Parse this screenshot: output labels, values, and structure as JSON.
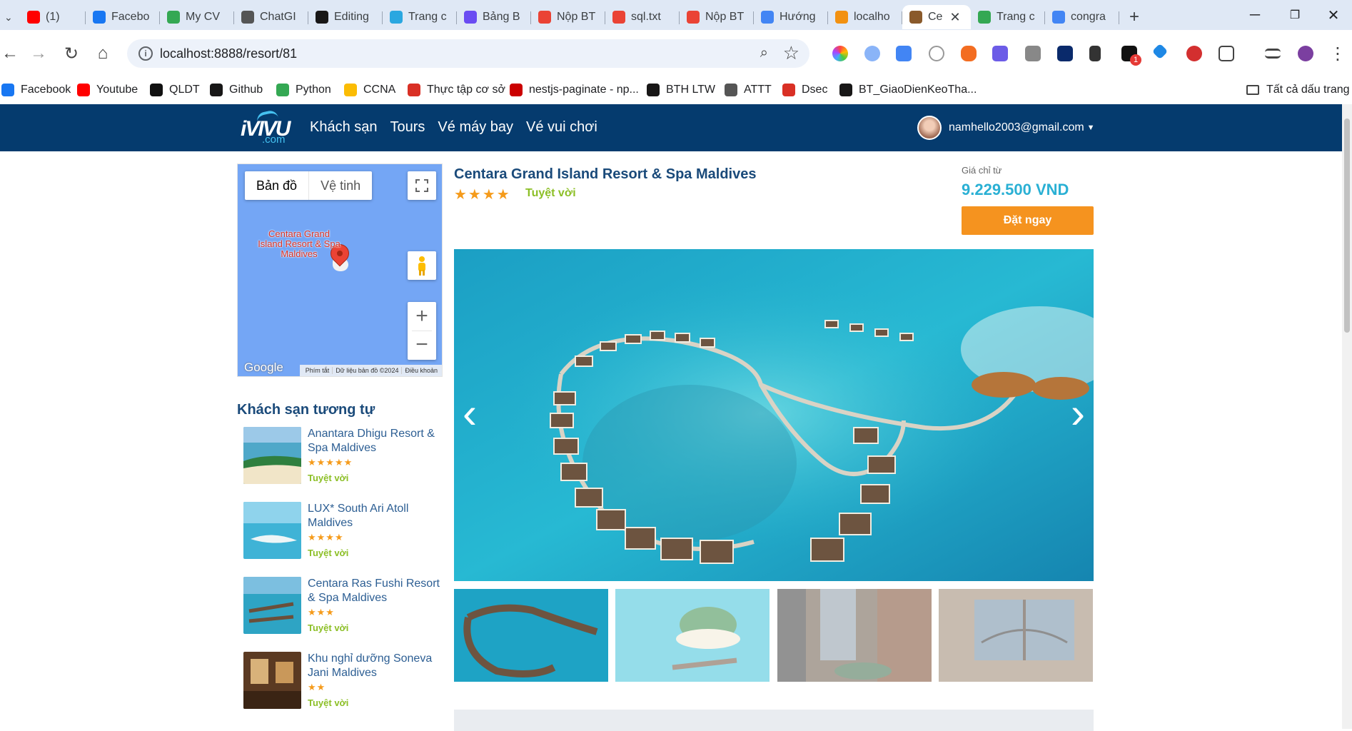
{
  "browser": {
    "tabs": [
      {
        "label": "(1)",
        "icon": "youtube-icon",
        "color": "#ff0000"
      },
      {
        "label": "Facebo",
        "icon": "facebook-icon",
        "color": "#1877f2"
      },
      {
        "label": "My CV",
        "icon": "cv-icon",
        "color": "#34a853"
      },
      {
        "label": "ChatGI",
        "icon": "chatgpt-icon",
        "color": "#555555"
      },
      {
        "label": "Editing",
        "icon": "github-icon",
        "color": "#181717"
      },
      {
        "label": "Trang c",
        "icon": "canva-icon",
        "color": "#2aa7e0"
      },
      {
        "label": "Bảng B",
        "icon": "board-icon",
        "color": "#6a4cf2"
      },
      {
        "label": "Nộp BT",
        "icon": "gmail-icon",
        "color": "#ea4335"
      },
      {
        "label": "sql.txt",
        "icon": "gmail-icon",
        "color": "#ea4335"
      },
      {
        "label": "Nộp BT",
        "icon": "gmail-icon",
        "color": "#ea4335"
      },
      {
        "label": "Hướng",
        "icon": "docs-icon",
        "color": "#4285f4"
      },
      {
        "label": "localho",
        "icon": "pma-icon",
        "color": "#f29111"
      },
      {
        "label": "Ce",
        "icon": "ivivu-icon",
        "color": "#8a5a2b",
        "active": true
      },
      {
        "label": "Trang c",
        "icon": "drive-icon",
        "color": "#34a853"
      },
      {
        "label": "congra",
        "icon": "google-icon",
        "color": "#4285f4"
      }
    ],
    "url": "localhost:8888/resort/81",
    "bookmarks": [
      {
        "label": "Facebook",
        "color": "#1877f2"
      },
      {
        "label": "Youtube",
        "color": "#ff0000"
      },
      {
        "label": "QLDT",
        "color": "#111111"
      },
      {
        "label": "Github",
        "color": "#181717"
      },
      {
        "label": "Python",
        "color": "#34a853"
      },
      {
        "label": "CCNA",
        "color": "#fbbc04"
      },
      {
        "label": "Thực tập cơ sở",
        "color": "#d93025"
      },
      {
        "label": "nestjs-paginate - np...",
        "color": "#cb0000"
      },
      {
        "label": "BTH LTW",
        "color": "#181717"
      },
      {
        "label": "ATTT",
        "color": "#555555"
      },
      {
        "label": "Dsec",
        "color": "#d93025"
      },
      {
        "label": "BT_GiaoDienKeoTha...",
        "color": "#181717"
      }
    ],
    "all_bookmarks_label": "Tất cả dấu trang",
    "notif_badge": "1"
  },
  "site": {
    "logo_text": "iVIVU",
    "logo_domain": ".com",
    "nav": [
      "Khách sạn",
      "Tours",
      "Vé máy bay",
      "Vé vui chơi"
    ],
    "user_email": "namhello2003@gmail.com"
  },
  "map": {
    "type_map": "Bản đồ",
    "type_satellite": "Vệ tinh",
    "marker_label": "Centara Grand Island Resort & Spa Maldives",
    "google_logo": "Google",
    "footer": [
      "Phím tắt",
      "Dữ liệu bản đồ ©2024",
      "Điều khoản"
    ]
  },
  "similar": {
    "title": "Khách sạn tương tự",
    "items": [
      {
        "name": "Anantara Dhigu Resort & Spa Maldives",
        "stars": "★★★★★",
        "rating": "Tuyệt vời"
      },
      {
        "name": "LUX* South Ari Atoll Maldives",
        "stars": "★★★★",
        "rating": "Tuyệt vời"
      },
      {
        "name": "Centara Ras Fushi Resort & Spa Maldives",
        "stars": "★★★",
        "rating": "Tuyệt vời"
      },
      {
        "name": "Khu nghỉ dưỡng Soneva Jani Maldives",
        "stars": "★★",
        "rating": "Tuyệt vời"
      }
    ]
  },
  "hotel": {
    "name": "Centara Grand Island Resort & Spa Maldives",
    "stars": "★★★★",
    "rating": "Tuyệt vời",
    "price_label": "Giá chỉ từ",
    "price": "9.229.500 VND",
    "book_label": "Đặt ngay"
  },
  "colors": {
    "header_bg": "#053b6e",
    "book_button": "#f5931f",
    "price": "#2ab0d4",
    "rating": "#8cbf26",
    "stars": "#f59b1b"
  }
}
